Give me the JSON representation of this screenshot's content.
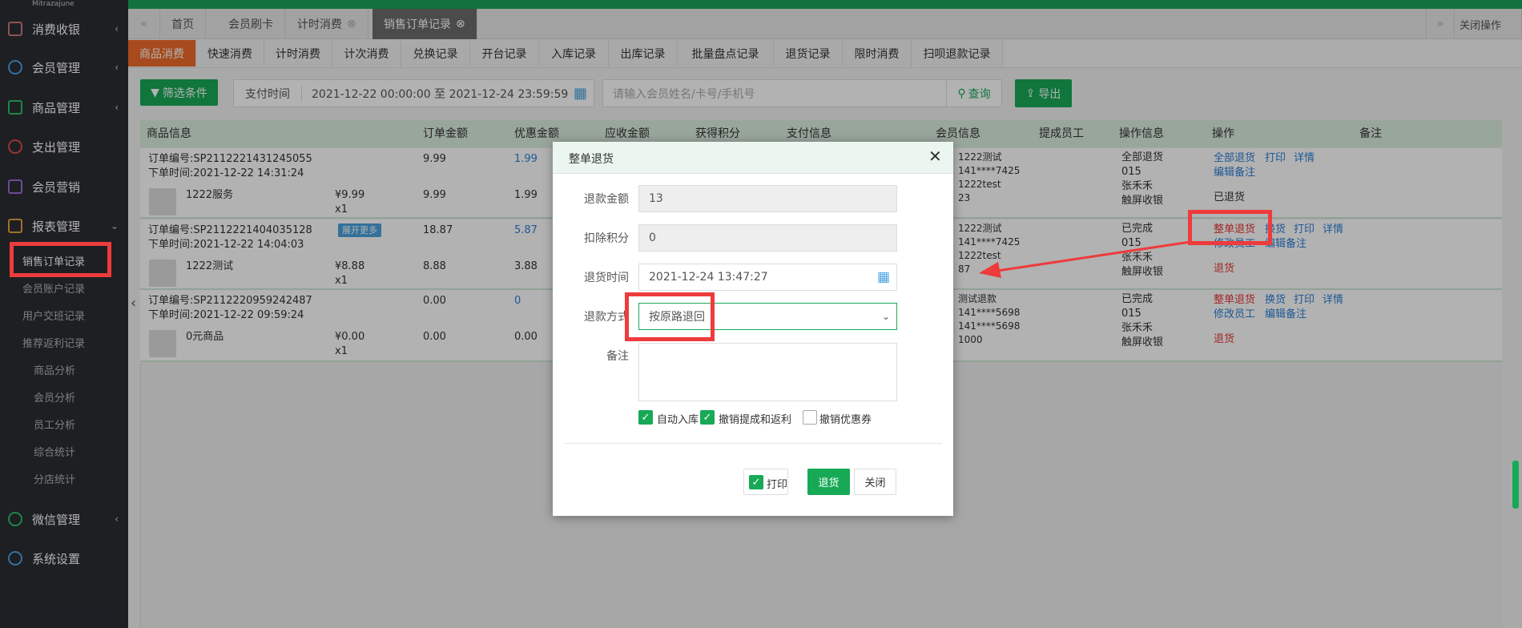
{
  "sidebar": {
    "logo": "Mitrazajune",
    "items": [
      {
        "label": "消费收银",
        "icon": "register-icon"
      },
      {
        "label": "会员管理",
        "icon": "members-icon"
      },
      {
        "label": "商品管理",
        "icon": "goods-icon"
      },
      {
        "label": "支出管理",
        "icon": "expense-icon"
      },
      {
        "label": "会员营销",
        "icon": "gift-icon"
      },
      {
        "label": "报表管理",
        "icon": "report-icon"
      },
      {
        "label": "微信管理",
        "icon": "wechat-icon"
      },
      {
        "label": "系统设置",
        "icon": "gear-icon"
      }
    ],
    "report_sub": [
      "销售订单记录",
      "会员账户记录",
      "用户交班记录",
      "推荐返利记录",
      "商品分析",
      "会员分析",
      "员工分析",
      "综合统计",
      "分店统计"
    ]
  },
  "tabs": {
    "items": [
      "首页",
      "会员刷卡",
      "计时消费",
      "销售订单记录"
    ],
    "close_ops": "关闭操作"
  },
  "subtabs": [
    "商品消费",
    "快速消费",
    "计时消费",
    "计次消费",
    "兑换记录",
    "开台记录",
    "入库记录",
    "出库记录",
    "批量盘点记录",
    "退货记录",
    "限时消费",
    "扫呗退款记录"
  ],
  "filters": {
    "filter_button": "筛选条件",
    "pay_time_label": "支付时间",
    "date_range": "2021-12-22 00:00:00 至 2021-12-24 23:59:59",
    "search_placeholder": "请输入会员姓名/卡号/手机号",
    "query_button": "查询",
    "export_button": "导出"
  },
  "grid": {
    "headers": [
      "商品信息",
      "订单金额",
      "优惠金额",
      "应收金额",
      "获得积分",
      "支付信息",
      "会员信息",
      "提成员工",
      "操作信息",
      "操作",
      "备注"
    ],
    "orders": [
      {
        "order_no": "订单编号:SP2112221431245055",
        "order_time": "下单时间:2021-12-22 14:31:24",
        "amount": "9.99",
        "discount": "1.99",
        "product": "1222服务",
        "price": "¥9.99",
        "qty": "x1",
        "p_amount": "9.99",
        "p_discount": "1.99",
        "member": [
          "名：1222测试",
          "机：141****7425",
          "号：1222test",
          "额：23"
        ],
        "ops_info": [
          "全部退货",
          "015",
          "张禾禾",
          "触屏收银"
        ],
        "actions1": [
          "全部退货",
          "打印",
          "详情"
        ],
        "actions2": [
          "编辑备注"
        ],
        "status": "已退货"
      },
      {
        "order_no": "订单编号:SP2112221404035128",
        "badge": "展开更多",
        "order_time": "下单时间:2021-12-22 14:04:03",
        "amount": "18.87",
        "discount": "5.87",
        "product": "1222测试",
        "price": "¥8.88",
        "qty": "x1",
        "p_amount": "8.88",
        "p_discount": "3.88",
        "member": [
          "名：1222测试",
          "机：141****7425",
          "号：1222test",
          "额：87"
        ],
        "ops_info": [
          "已完成",
          "015",
          "张禾禾",
          "触屏收银"
        ],
        "actions1": [
          "整单退货",
          "换货",
          "打印",
          "详情"
        ],
        "actions2": [
          "修改员工",
          "编辑备注"
        ],
        "status": "退货"
      },
      {
        "order_no": "订单编号:SP2112220959242487",
        "order_time": "下单时间:2021-12-22 09:59:24",
        "amount": "0.00",
        "discount": "0",
        "product": "0元商品",
        "price": "¥0.00",
        "qty": "x1",
        "p_amount": "0.00",
        "p_discount": "0.00",
        "member": [
          "名：测试退款",
          "机：141****5698",
          "号：141****5698",
          "额：1000"
        ],
        "ops_info": [
          "已完成",
          "015",
          "张禾禾",
          "触屏收银"
        ],
        "actions1": [
          "整单退货",
          "换货",
          "打印",
          "详情"
        ],
        "actions2": [
          "修改员工",
          "编辑备注"
        ],
        "status": "退货"
      }
    ]
  },
  "modal": {
    "title": "整单退货",
    "refund_amount_label": "退款金额",
    "refund_amount": "13",
    "deduct_points_label": "扣除积分",
    "deduct_points": "0",
    "return_time_label": "退货时间",
    "return_time": "2021-12-24 13:47:27",
    "refund_method_label": "退款方式",
    "refund_method": "按原路退回",
    "remark_label": "备注",
    "auto_stock": "自动入库",
    "revoke_commission": "撤销提成和返利",
    "revoke_coupon": "撤销优惠券",
    "print": "打印",
    "return_button": "退货",
    "close_button": "关闭"
  },
  "colors": {
    "green": "#18a957",
    "orange": "#f06a2a",
    "annotation": "#ee3b3b",
    "sidebar": "#2a2d33"
  }
}
